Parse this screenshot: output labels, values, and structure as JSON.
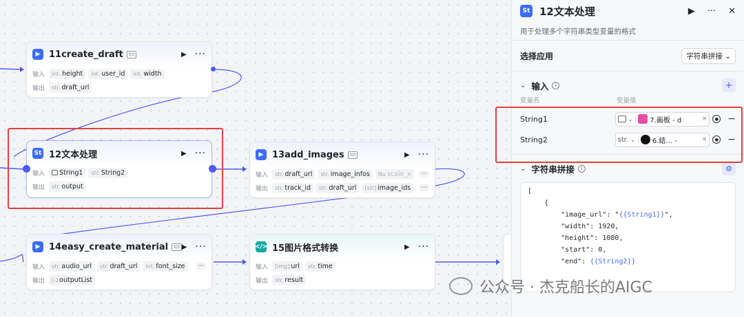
{
  "nodes": {
    "n11": {
      "title": "11create_draft",
      "icon": "play-icon",
      "input_label": "输入",
      "output_label": "输出",
      "inputs": [
        {
          "type": "int.",
          "name": "height"
        },
        {
          "type": "int.",
          "name": "user_id"
        },
        {
          "type": "int.",
          "name": "width"
        }
      ],
      "outputs": [
        {
          "type": "str.",
          "name": "draft_url"
        }
      ]
    },
    "n12": {
      "title": "12文本处理",
      "icon": "text-process-icon",
      "input_label": "输入",
      "output_label": "输出",
      "inputs": [
        {
          "type": "img",
          "name": "String1"
        },
        {
          "type": "str.",
          "name": "String2"
        }
      ],
      "outputs": [
        {
          "type": "str.",
          "name": "output"
        }
      ]
    },
    "n13": {
      "title": "13add_images",
      "icon": "play-icon",
      "input_label": "输入",
      "output_label": "输出",
      "inputs": [
        {
          "type": "str.",
          "name": "draft_url"
        },
        {
          "type": "str.",
          "name": "image_infos"
        },
        {
          "type": "Nu",
          "name": "scale_x"
        }
      ],
      "outputs": [
        {
          "type": "str.",
          "name": "track_id"
        },
        {
          "type": "str.",
          "name": "draft_url"
        },
        {
          "type": "[str]",
          "name": "image_ids"
        }
      ]
    },
    "n14": {
      "title": "14easy_create_material",
      "icon": "play-icon",
      "input_label": "输入",
      "output_label": "输出",
      "inputs": [
        {
          "type": "str.",
          "name": "audio_url"
        },
        {
          "type": "str.",
          "name": "draft_url"
        },
        {
          "type": "int.",
          "name": "font_size"
        }
      ],
      "outputs": [
        {
          "type": "[-]",
          "name": "outputList"
        }
      ]
    },
    "n15": {
      "title": "15图片格式转换",
      "icon": "code-icon",
      "input_label": "输入",
      "output_label": "输出",
      "inputs": [
        {
          "type": "[img]",
          "name": "url"
        },
        {
          "type": "str.",
          "name": "time"
        }
      ],
      "outputs": [
        {
          "type": "str.",
          "name": "result"
        }
      ]
    },
    "more": "···"
  },
  "panel": {
    "title": "12文本处理",
    "description": "用于处理多个字符串类型变量的格式",
    "app_label": "选择应用",
    "app_value": "字符串拼接",
    "input_section": "输入",
    "col_var_name": "变量名",
    "col_var_value": "变量值",
    "variables": [
      {
        "name": "String1",
        "type": "img",
        "ref": "7.画板 - d"
      },
      {
        "name": "String2",
        "type": "str.",
        "ref": "6.结...  - "
      }
    ],
    "concat_section": "字符串拼接",
    "code_lines": [
      "[",
      "    {",
      "        \"image_url\": \"",
      "        \"width\": 1920,",
      "        \"height\": 1080,",
      "        \"start\": 0,",
      "        \"end\": "
    ],
    "ref_string1": "{{String1}}",
    "ref_string2": "{{String2}}",
    "ref_suffix": "\","
  },
  "watermark": "公众号 · 杰克船长的AIGC",
  "colors": {
    "accent": "#4b5cf0",
    "highlight": "#e0413c",
    "node_icon": "#3b6cf6",
    "code_icon": "#18a9a3"
  }
}
